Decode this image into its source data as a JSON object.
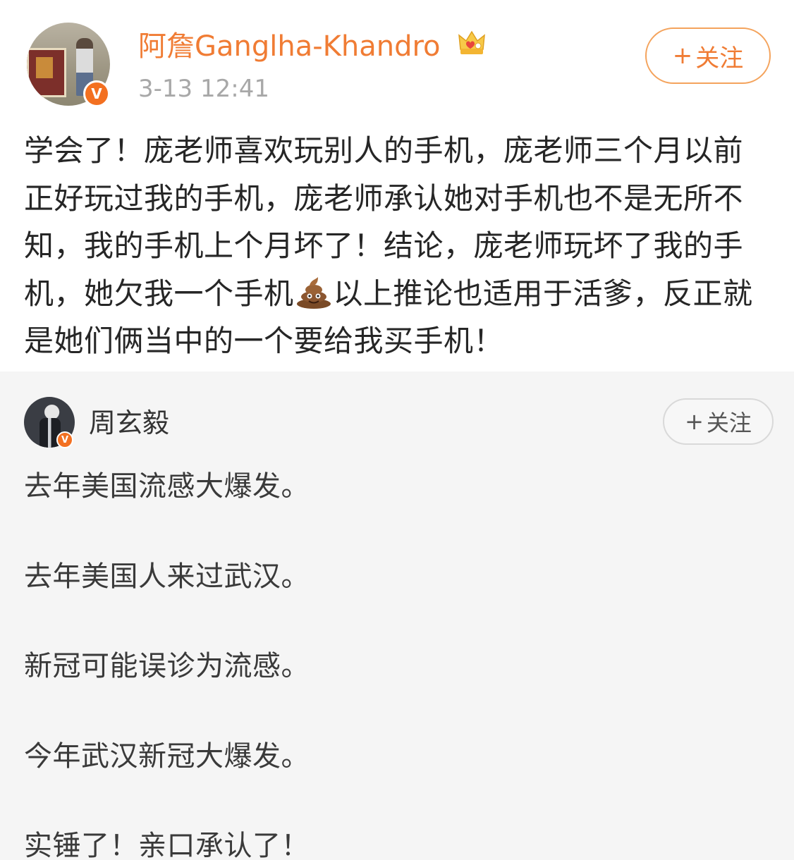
{
  "post": {
    "username": "阿詹Ganglha-Khandro",
    "timestamp": "3-13 12:41",
    "follow_label": "关注",
    "follow_plus": "+",
    "text_part1": "学会了！庞老师喜欢玩别人的手机，庞老师三个月以前正好玩过我的手机，庞老师承认她对手机也不是无所不知，我的手机上个月坏了！结论，庞老师玩坏了我的手机，她欠我一个手机",
    "text_part2": "以上推论也适用于活爹，反正就是她们俩当中的一个要给我买手机！",
    "icons": {
      "verified": "verified-badge-icon",
      "member": "crown-icon",
      "emoji": "poop-emoji-icon"
    },
    "verified_glyph": "V"
  },
  "quote": {
    "username": "周玄毅",
    "follow_label": "关注",
    "follow_plus": "+",
    "verified_glyph": "V",
    "lines": [
      "去年美国流感大爆发。",
      "去年美国人来过武汉。",
      "新冠可能误诊为流感。",
      "今年武汉新冠大爆发。",
      "实锤了！亲口承认了！"
    ]
  },
  "colors": {
    "accent": "#f07c34",
    "verified": "#f37021",
    "quote_bg": "#f5f5f5"
  }
}
